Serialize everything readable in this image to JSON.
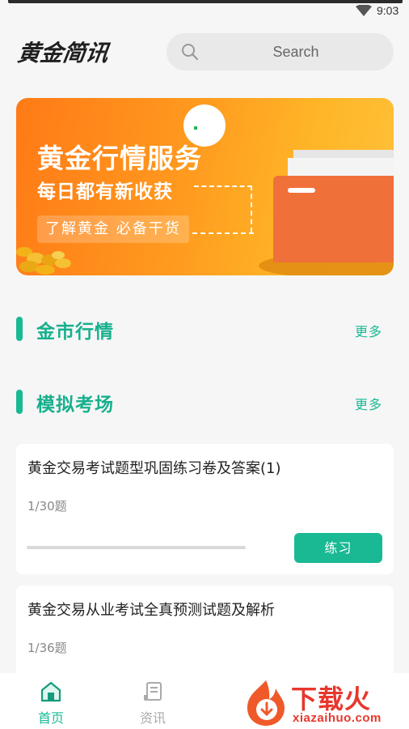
{
  "status_bar": {
    "time": "9:03"
  },
  "header": {
    "logo_text": "黄金简讯",
    "search_placeholder": "Search"
  },
  "banner": {
    "title": "黄金行情服务",
    "subtitle": "每日都有新收获",
    "tag": "了解黄金  必备干货"
  },
  "sections": [
    {
      "title": "金市行情",
      "more": "更多"
    },
    {
      "title": "模拟考场",
      "more": "更多"
    }
  ],
  "exams": [
    {
      "title": "黄金交易考试题型巩固练习卷及答案(1)",
      "count": "1/30题",
      "progress": 0.0,
      "button": "练习"
    },
    {
      "title": "黄金交易从业考试全真预测试题及解析",
      "count": "1/36题"
    }
  ],
  "tabbar": {
    "items": [
      {
        "label": "首页",
        "icon": "home-icon",
        "active": true
      },
      {
        "label": "资讯",
        "icon": "news-icon",
        "active": false
      }
    ]
  },
  "watermark": {
    "text": "下载火",
    "url": "xiazaihuo.com"
  },
  "colors": {
    "accent": "#19b994",
    "banner_orange": "#ff8a1c",
    "watermark_red": "#e8372c"
  }
}
